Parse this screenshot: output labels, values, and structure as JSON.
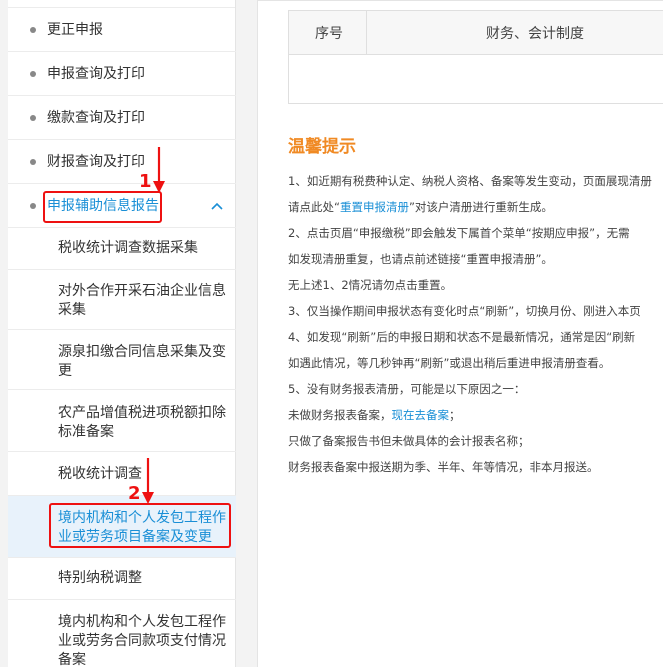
{
  "sidebar": {
    "items": [
      {
        "label": "更正申报"
      },
      {
        "label": "申报查询及打印"
      },
      {
        "label": "缴款查询及打印"
      },
      {
        "label": "财报查询及打印"
      },
      {
        "label": "申报辅助信息报告"
      }
    ],
    "sub_items": [
      {
        "label": "税收统计调查数据采集"
      },
      {
        "label": "对外合作开采石油企业信息采集"
      },
      {
        "label": "源泉扣缴合同信息采集及变更"
      },
      {
        "label": "农产品增值税进项税额扣除标准备案"
      },
      {
        "label": "税收统计调查"
      },
      {
        "label": "境内机构和个人发包工程作业或劳务项目备案及变更"
      },
      {
        "label": "特别纳税调整"
      },
      {
        "label": "境内机构和个人发包工程作业或劳务合同款项支付情况备案"
      }
    ]
  },
  "annotations": {
    "step1": "1",
    "step2": "2"
  },
  "table": {
    "col1": "序号",
    "col2": "财务、会计制度"
  },
  "tips": {
    "title": "温馨提示",
    "l1": "1、如近期有税费种认定、纳税人资格、备案等发生变动，页面展现清册",
    "l2a": "请点此处“",
    "l2link": "重置申报清册",
    "l2b": "”对该户清册进行重新生成。",
    "l3": "2、点击页眉“申报缴税”即会触发下属首个菜单“按期应申报”，无需",
    "l4": "如发现清册重复，也请点前述链接“重置申报清册”。",
    "l5": "无上述1、2情况请勿点击重置。",
    "l6": "3、仅当操作期间申报状态有变化时点“刷新”，切换月份、刚进入本页",
    "l7": "4、如发现“刷新”后的申报日期和状态不是最新情况，通常是因“刷新",
    "l8": "如遇此情况，等几秒钟再“刷新”或退出稍后重进申报清册查看。",
    "l9": "5、没有财务报表清册，可能是以下原因之一：",
    "l10a": "未做财务报表备案，",
    "l10link": "现在去备案",
    "l10b": "；",
    "l11": "只做了备案报告书但未做具体的会计报表名称；",
    "l12": "财务报表备案中报送期为季、半年、年等情况，非本月报送。"
  }
}
